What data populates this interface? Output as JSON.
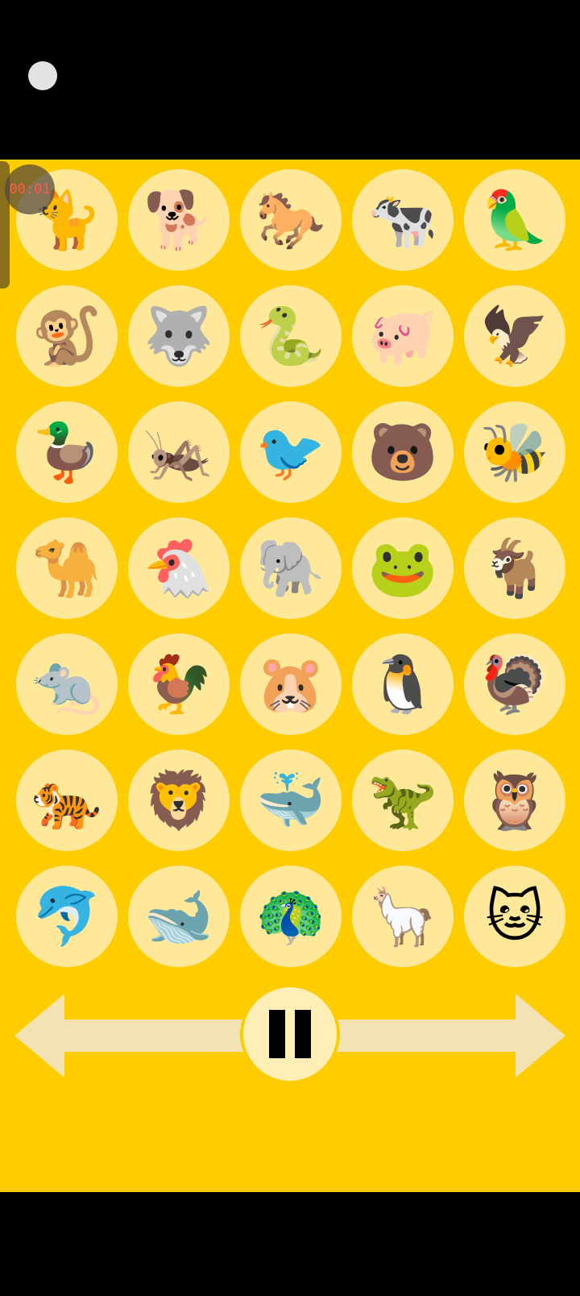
{
  "timer": {
    "text": "00:01"
  },
  "colors": {
    "background": "#ffcc00",
    "tile": "#ffe89a",
    "arrow": "#f3e3b3",
    "timer_text": "#ff5a4a"
  },
  "tiles": [
    {
      "icon": "tiger-cat-icon",
      "glyph": "🐈"
    },
    {
      "icon": "dog-icon",
      "glyph": "🐕"
    },
    {
      "icon": "horse-icon",
      "glyph": "🐎"
    },
    {
      "icon": "cow-icon",
      "glyph": "🐄"
    },
    {
      "icon": "parrot-icon",
      "glyph": "🦜"
    },
    {
      "icon": "monkey-icon",
      "glyph": "🐒"
    },
    {
      "icon": "wolf-icon",
      "glyph": "🐺"
    },
    {
      "icon": "snake-icon",
      "glyph": "🐍"
    },
    {
      "icon": "pig-icon",
      "glyph": "🐖"
    },
    {
      "icon": "eagle-icon",
      "glyph": "🦅"
    },
    {
      "icon": "duck-icon",
      "glyph": "🦆"
    },
    {
      "icon": "cricket-icon",
      "glyph": "🦗"
    },
    {
      "icon": "cardinal-icon",
      "glyph": "🐦"
    },
    {
      "icon": "bear-icon",
      "glyph": "🐻"
    },
    {
      "icon": "bee-icon",
      "glyph": "🐝"
    },
    {
      "icon": "camel-icon",
      "glyph": "🐪"
    },
    {
      "icon": "chicken-icon",
      "glyph": "🐔"
    },
    {
      "icon": "elephant-icon",
      "glyph": "🐘"
    },
    {
      "icon": "frog-icon",
      "glyph": "🐸"
    },
    {
      "icon": "goat-icon",
      "glyph": "🐐"
    },
    {
      "icon": "rat-icon",
      "glyph": "🐀"
    },
    {
      "icon": "rooster-icon",
      "glyph": "🐓"
    },
    {
      "icon": "hamster-icon",
      "glyph": "🐹"
    },
    {
      "icon": "penguin-icon",
      "glyph": "🐧"
    },
    {
      "icon": "turkey-icon",
      "glyph": "🦃"
    },
    {
      "icon": "tiger-icon",
      "glyph": "🐅"
    },
    {
      "icon": "lion-icon",
      "glyph": "🦁"
    },
    {
      "icon": "whale-icon",
      "glyph": "🐳"
    },
    {
      "icon": "t-rex-icon",
      "glyph": "🦖"
    },
    {
      "icon": "owl-icon",
      "glyph": "🦉"
    },
    {
      "icon": "dolphin-icon",
      "glyph": "🐬"
    },
    {
      "icon": "spouting-whale-icon",
      "glyph": "🐋"
    },
    {
      "icon": "peacock-icon",
      "glyph": "🦚"
    },
    {
      "icon": "llama-icon",
      "glyph": "🦙"
    },
    {
      "icon": "cat-face-icon",
      "glyph": "🐱"
    }
  ],
  "controls": {
    "left": {
      "icon": "arrow-left-icon"
    },
    "pause": {
      "icon": "pause-icon"
    },
    "right": {
      "icon": "arrow-right-icon"
    }
  }
}
